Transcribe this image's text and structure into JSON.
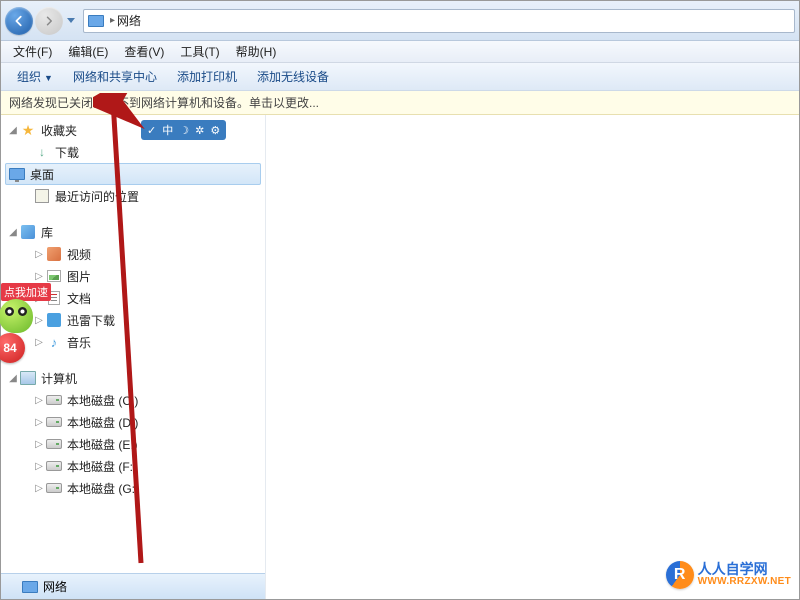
{
  "titlebar": {
    "location": "网络"
  },
  "menubar": {
    "file": "文件(F)",
    "edit": "编辑(E)",
    "view": "查看(V)",
    "tools": "工具(T)",
    "help": "帮助(H)"
  },
  "toolbar": {
    "organize": "组织",
    "network_center": "网络和共享中心",
    "add_printer": "添加打印机",
    "add_wireless": "添加无线设备"
  },
  "infobar": {
    "message": "网络发现已关闭。看不到网络计算机和设备。单击以更改..."
  },
  "sidebar": {
    "favorites": {
      "label": "收藏夹",
      "downloads": "下载",
      "desktop": "桌面",
      "recent": "最近访问的位置"
    },
    "libraries": {
      "label": "库",
      "videos": "视频",
      "pictures": "图片",
      "documents": "文档",
      "xunlei": "迅雷下载",
      "music": "音乐"
    },
    "computer": {
      "label": "计算机",
      "disk_c": "本地磁盘 (C:)",
      "disk_d": "本地磁盘 (D:)",
      "disk_e": "本地磁盘 (E:)",
      "disk_f": "本地磁盘 (F:)",
      "disk_g": "本地磁盘 (G:)"
    },
    "network": {
      "label": "网络"
    }
  },
  "quickbar": {
    "i1": "✓",
    "i2": "中",
    "i3": "☽",
    "i4": "✲",
    "i5": "⚙"
  },
  "overlay": {
    "speedup": "点我加速",
    "badge_num": "84"
  },
  "watermark": {
    "brand": "人人自学网",
    "url": "WWW.RRZXW.NET"
  }
}
